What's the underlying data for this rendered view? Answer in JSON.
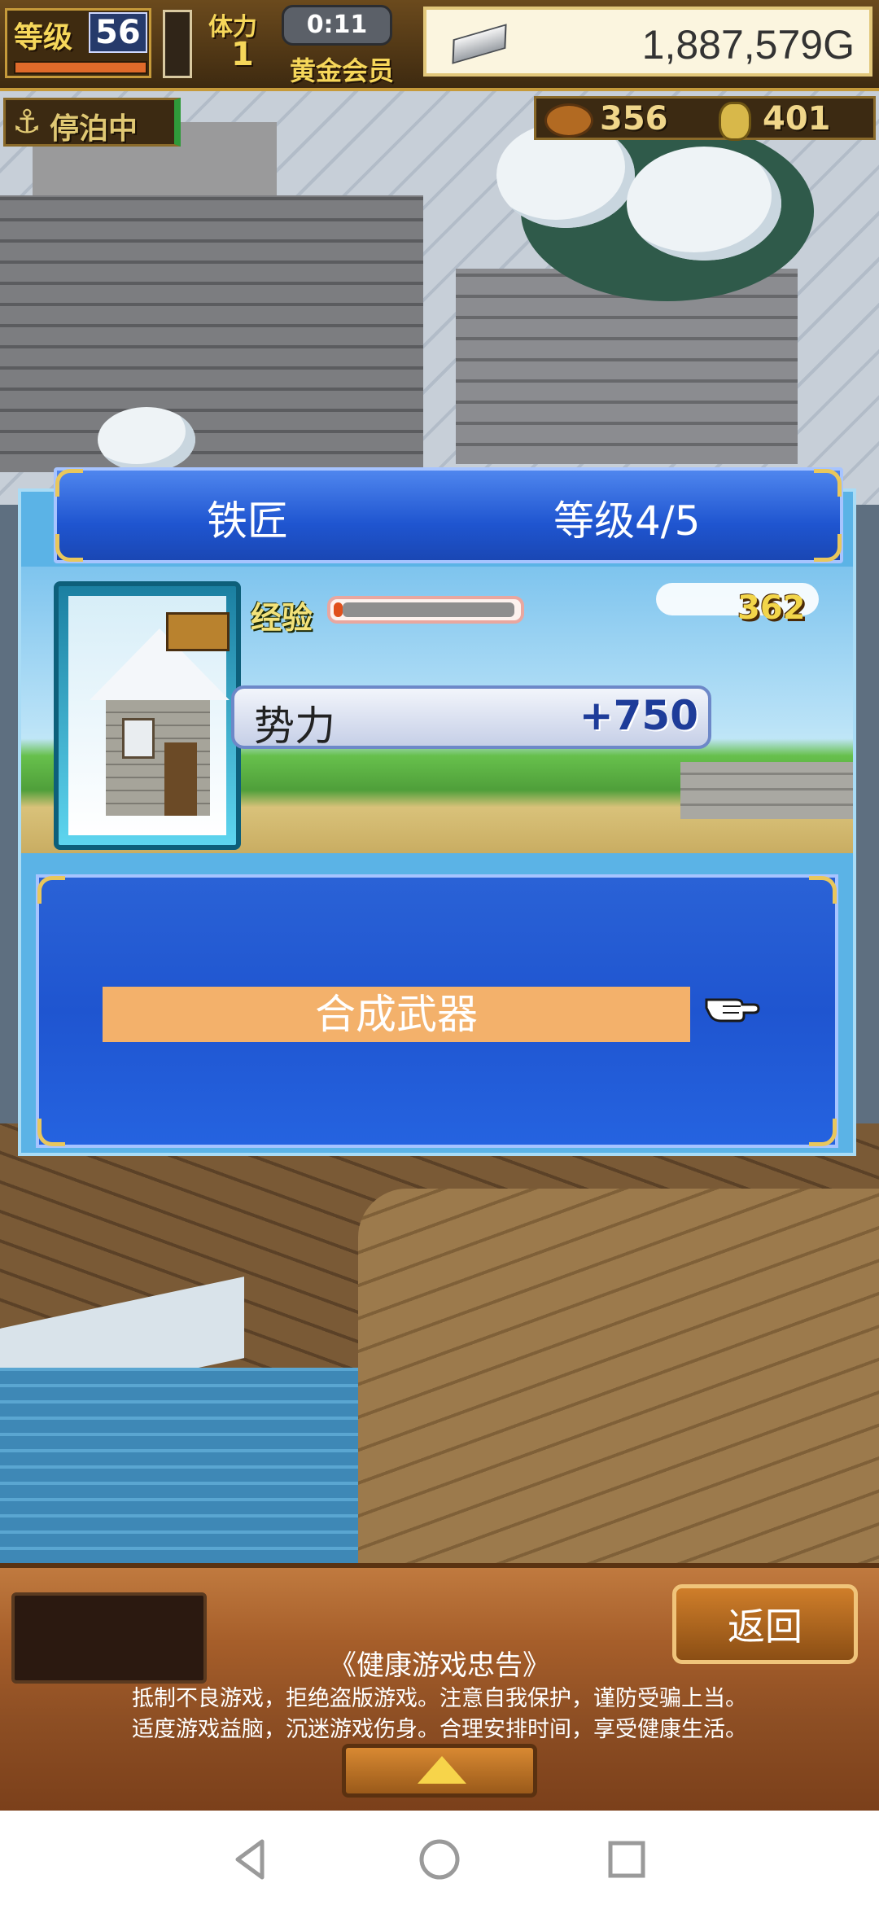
{
  "hud": {
    "level_label": "等级",
    "level_value": "56",
    "stamina_label": "体力",
    "stamina_value": "1",
    "timer": "0:11",
    "membership": "黄金会员",
    "gold": "1,887,579G",
    "dock_status": "停泊中",
    "resource_1": "356",
    "resource_2": "401"
  },
  "dialog": {
    "building_name": "铁匠",
    "level_text": "等级4/5",
    "exp_label": "经验",
    "exp_value": "362",
    "exp_progress": 0.05,
    "power_label": "势力",
    "power_value": "+750",
    "menu_items": [
      {
        "label": "合成武器"
      }
    ]
  },
  "bottom": {
    "back_label": "返回",
    "notice_title": "《健康游戏忠告》",
    "notice_line_1": "抵制不良游戏，拒绝盗版游戏。注意自我保护，谨防受骗上当。",
    "notice_line_2": "适度游戏益脑，沉迷游戏伤身。合理安排时间，享受健康生活。"
  },
  "colors": {
    "dialog_header": "#1f55d0",
    "menu_button": "#f3b16b",
    "exp_fill": "#e0501c",
    "power_text": "#1e3c99"
  },
  "icons": [
    "anchor-icon",
    "meat-icon",
    "coin-icon",
    "silver-ingot-icon",
    "pointing-hand-icon",
    "up-triangle-icon",
    "nav-back-icon",
    "nav-home-icon",
    "nav-recent-icon"
  ]
}
